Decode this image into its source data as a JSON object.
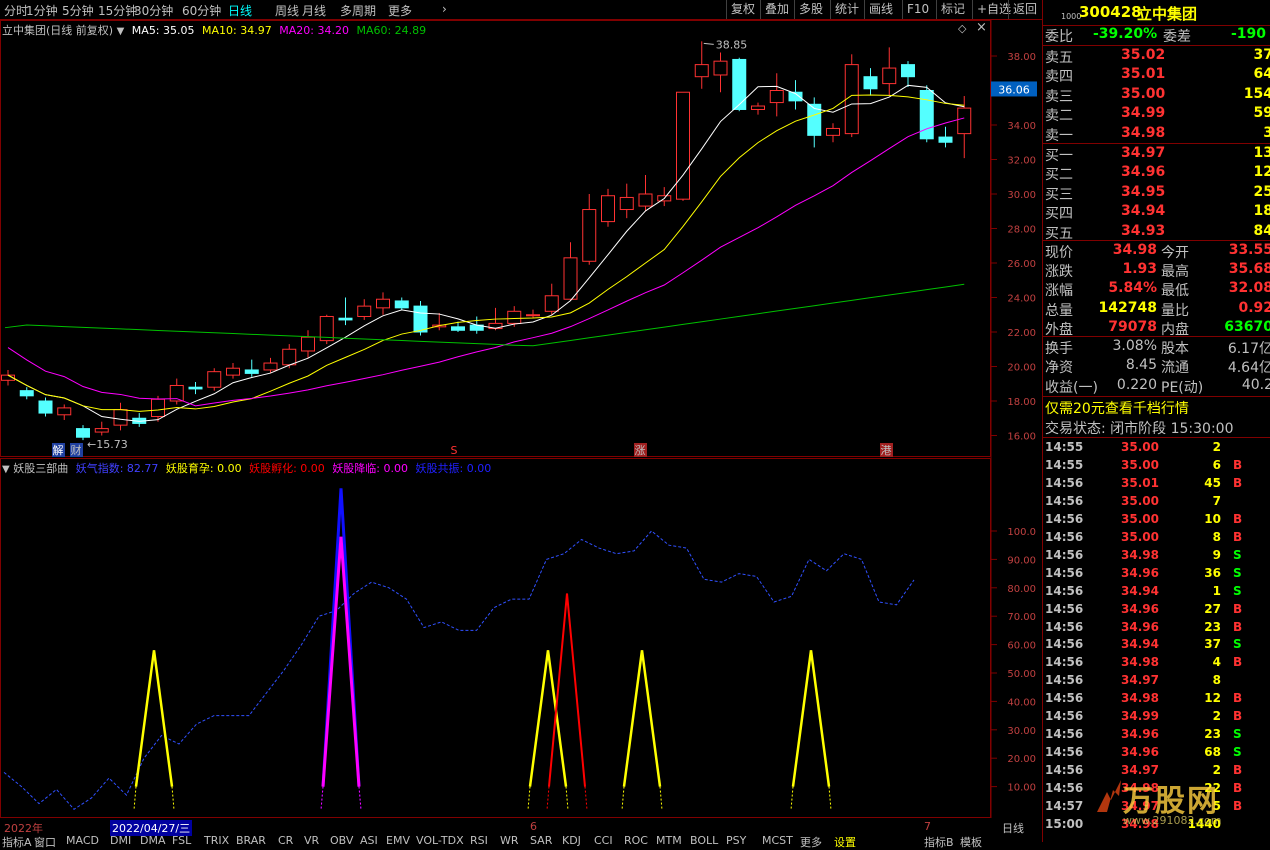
{
  "toolbar": {
    "timeframes": [
      "分时",
      "1分钟",
      "5分钟",
      "15分钟",
      "30分钟",
      "60分钟",
      "日线",
      "周线",
      "月线",
      "多周期",
      "更多"
    ],
    "active_timeframe": "日线",
    "buttons": [
      "复权",
      "叠加",
      "多股",
      "统计",
      "画线",
      "F10",
      "标记",
      "+自选",
      "返回"
    ]
  },
  "chart_header": {
    "title": "立中集团(日线 前复权)",
    "ma5": "MA5: 35.05",
    "ma10": "MA10: 34.97",
    "ma20": "MA20: 34.20",
    "ma60": "MA60: 24.89"
  },
  "price_axis": [
    "38.00",
    "36.00",
    "34.00",
    "32.00",
    "30.00",
    "28.00",
    "26.00",
    "24.00",
    "22.00",
    "20.00",
    "18.00",
    "16.00"
  ],
  "current_price_tag": "36.06",
  "high_label": "38.85",
  "low_label": "15.73",
  "event_marks": {
    "jie": "解",
    "cai": "财",
    "s": "S",
    "zhang": "涨",
    "gang": "港"
  },
  "indicator_header": {
    "name": "妖股三部曲",
    "yaoqi": "妖气指数: 82.77",
    "yunyu": "妖股育孕: 0.00",
    "fuhua": "妖股孵化: 0.00",
    "jianglin": "妖股降临: 0.00",
    "gongzhen": "妖股共振: 0.00"
  },
  "indicator_axis": [
    "100.0",
    "90.00",
    "80.00",
    "70.00",
    "60.00",
    "50.00",
    "40.00",
    "30.00",
    "20.00",
    "10.00"
  ],
  "time_axis": {
    "year": "2022年",
    "cursor_date": "2022/04/27/三",
    "m6": "6",
    "m7": "7",
    "period": "日线"
  },
  "bottom_tabs": [
    "指标A",
    "窗口",
    "MACD",
    "DMI",
    "DMA",
    "FSL",
    "TRIX",
    "BRAR",
    "CR",
    "VR",
    "OBV",
    "ASI",
    "EMV",
    "VOL-TDX",
    "RSI",
    "WR",
    "SAR",
    "KDJ",
    "CCI",
    "ROC",
    "MTM",
    "BOLL",
    "PSY",
    "MCST",
    "更多",
    "设置"
  ],
  "bottom_right_tabs": [
    "指标B",
    "模板"
  ],
  "quote": {
    "code": "300428",
    "name": "立中集团",
    "small_tag": "1000",
    "weibi_label": "委比",
    "weibi": "-39.20%",
    "weicha_label": "委差",
    "weicha": "-190",
    "sells": [
      {
        "label": "卖五",
        "price": "35.02",
        "vol": "37"
      },
      {
        "label": "卖四",
        "price": "35.01",
        "vol": "64"
      },
      {
        "label": "卖三",
        "price": "35.00",
        "vol": "154"
      },
      {
        "label": "卖二",
        "price": "34.99",
        "vol": "59"
      },
      {
        "label": "卖一",
        "price": "34.98",
        "vol": "3"
      }
    ],
    "buys": [
      {
        "label": "买一",
        "price": "34.97",
        "vol": "13"
      },
      {
        "label": "买二",
        "price": "34.96",
        "vol": "12"
      },
      {
        "label": "买三",
        "price": "34.95",
        "vol": "25"
      },
      {
        "label": "买四",
        "price": "34.94",
        "vol": "18"
      },
      {
        "label": "买五",
        "price": "34.93",
        "vol": "84"
      }
    ],
    "stats1": [
      {
        "l1": "现价",
        "v1": "34.98",
        "l2": "今开",
        "v2": "33.55"
      },
      {
        "l1": "涨跌",
        "v1": "1.93",
        "l2": "最高",
        "v2": "35.68"
      },
      {
        "l1": "涨幅",
        "v1": "5.84%",
        "l2": "最低",
        "v2": "32.08"
      },
      {
        "l1": "总量",
        "v1": "142748",
        "l2": "量比",
        "v2": "0.92"
      },
      {
        "l1": "外盘",
        "v1": "79078",
        "l2": "内盘",
        "v2": "63670"
      }
    ],
    "stats2": [
      {
        "l1": "换手",
        "v1": "3.08%",
        "l2": "股本",
        "v2": "6.17亿"
      },
      {
        "l1": "净资",
        "v1": "8.45",
        "l2": "流通",
        "v2": "4.64亿"
      },
      {
        "l1": "收益(一)",
        "v1": "0.220",
        "l2": "PE(动)",
        "v2": "40.2"
      }
    ],
    "promo": "仅需20元查看千档行情",
    "status": "交易状态: 闭市阶段 15:30:00"
  },
  "ticks": [
    {
      "t": "14:55",
      "p": "35.00",
      "v": "2",
      "s": ""
    },
    {
      "t": "14:55",
      "p": "35.00",
      "v": "6",
      "s": "B"
    },
    {
      "t": "14:56",
      "p": "35.01",
      "v": "45",
      "s": "B"
    },
    {
      "t": "14:56",
      "p": "35.00",
      "v": "7",
      "s": ""
    },
    {
      "t": "14:56",
      "p": "35.00",
      "v": "10",
      "s": "B"
    },
    {
      "t": "14:56",
      "p": "35.00",
      "v": "8",
      "s": "B"
    },
    {
      "t": "14:56",
      "p": "34.98",
      "v": "9",
      "s": "S"
    },
    {
      "t": "14:56",
      "p": "34.96",
      "v": "36",
      "s": "S"
    },
    {
      "t": "14:56",
      "p": "34.94",
      "v": "1",
      "s": "S"
    },
    {
      "t": "14:56",
      "p": "34.96",
      "v": "27",
      "s": "B"
    },
    {
      "t": "14:56",
      "p": "34.96",
      "v": "23",
      "s": "B"
    },
    {
      "t": "14:56",
      "p": "34.94",
      "v": "37",
      "s": "S"
    },
    {
      "t": "14:56",
      "p": "34.98",
      "v": "4",
      "s": "B"
    },
    {
      "t": "14:56",
      "p": "34.97",
      "v": "8",
      "s": ""
    },
    {
      "t": "14:56",
      "p": "34.98",
      "v": "12",
      "s": "B"
    },
    {
      "t": "14:56",
      "p": "34.99",
      "v": "2",
      "s": "B"
    },
    {
      "t": "14:56",
      "p": "34.96",
      "v": "23",
      "s": "S"
    },
    {
      "t": "14:56",
      "p": "34.96",
      "v": "68",
      "s": "S"
    },
    {
      "t": "14:56",
      "p": "34.97",
      "v": "2",
      "s": "B"
    },
    {
      "t": "14:56",
      "p": "34.98",
      "v": "22",
      "s": "B"
    },
    {
      "t": "14:57",
      "p": "34.97",
      "v": "5",
      "s": "B"
    },
    {
      "t": "15:00",
      "p": "34.98",
      "v": "1440",
      "s": ""
    }
  ],
  "watermark": {
    "brand": "万股网",
    "url": "www.291082.com"
  },
  "colors": {
    "up": "#ff3232",
    "down": "#54ffff",
    "ma5": "#ffffff",
    "ma10": "#ffff00",
    "ma20": "#ff00ff",
    "ma60": "#00c000",
    "grid": "#800000"
  }
}
